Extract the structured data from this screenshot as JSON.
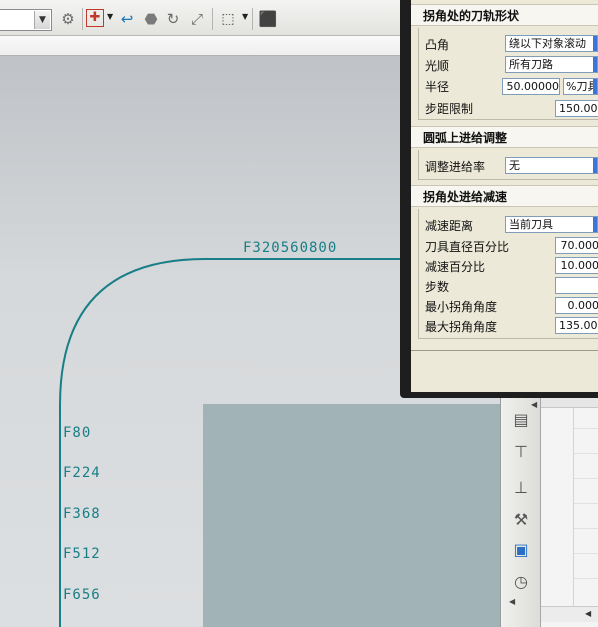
{
  "dialog": {
    "section_corner_shape": {
      "title": "拐角处的刀轨形状",
      "fields": [
        {
          "label": "凸角",
          "value": "绕以下对象滚动"
        },
        {
          "label": "光顺",
          "value": "所有刀路"
        },
        {
          "label": "半径",
          "value": "50.00000",
          "unit": "%刀具"
        },
        {
          "label": "步距限制",
          "value": "150.000"
        }
      ]
    },
    "section_arc_feed": {
      "title": "圆弧上进给调整",
      "fields": [
        {
          "label": "调整进给率",
          "value": "无"
        }
      ]
    },
    "section_corner_slowdown": {
      "title": "拐角处进给减速",
      "fields": [
        {
          "label": "减速距离",
          "value": "当前刀具"
        },
        {
          "label": "刀具直径百分比",
          "value": "70.000"
        },
        {
          "label": "减速百分比",
          "value": "10.000"
        },
        {
          "label": "步数",
          "value": ""
        },
        {
          "label": "最小拐角角度",
          "value": "0.000"
        },
        {
          "label": "最大拐角角度",
          "value": "135.000"
        }
      ]
    }
  },
  "graphics": {
    "top_label": "F320560800",
    "side_labels": [
      "F80",
      "F224",
      "F368",
      "F512",
      "F656"
    ],
    "colors": {
      "toolpath": "#197e86",
      "part": "#a1b3b7",
      "accent": "#3a76d8"
    }
  },
  "toolbar": {
    "icons": [
      "layer-icon",
      "snap-icon",
      "undo-arrow-icon",
      "shade-icon",
      "rotate-icon",
      "pan-icon",
      "select-box-icon",
      "view-cube-icon"
    ]
  },
  "side_toolbar": {
    "icons": [
      "operation-nav-icon",
      "tool-icon",
      "geometry-icon",
      "method-icon",
      "report-icon",
      "time-icon"
    ]
  }
}
